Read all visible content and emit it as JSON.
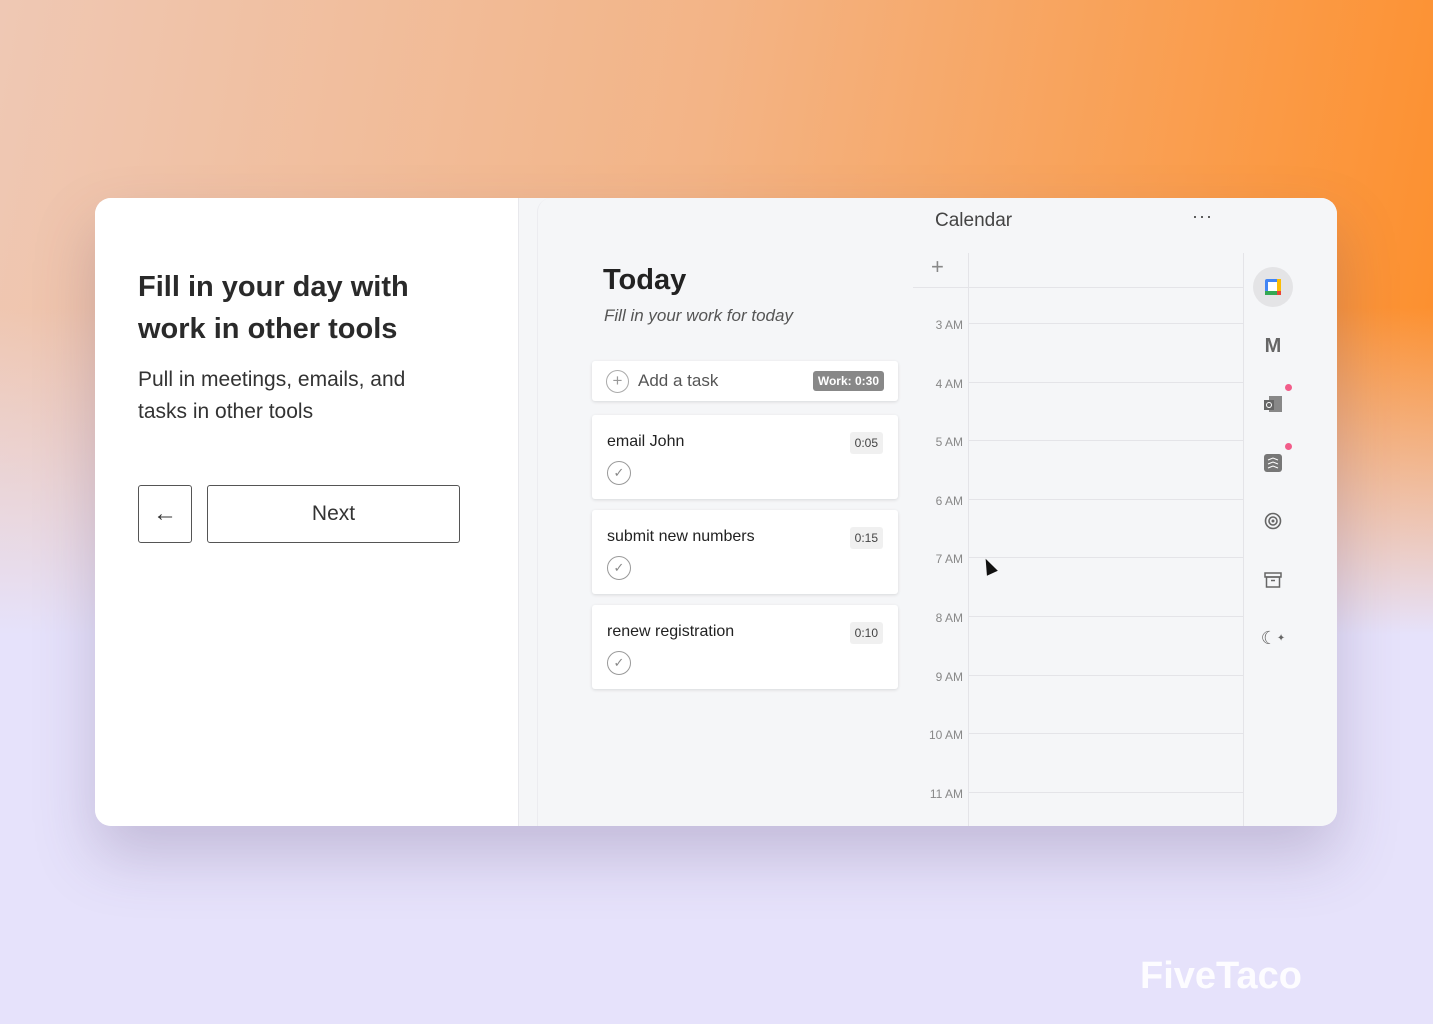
{
  "onboarding": {
    "title": "Fill in your day with work in other tools",
    "subtitle": "Pull in meetings, emails, and tasks in other tools",
    "back_icon": "arrow-left-icon",
    "next_label": "Next"
  },
  "calendar": {
    "title": "Calendar",
    "more_label": "···",
    "add_label": "+",
    "hours": [
      "3 AM",
      "4 AM",
      "5 AM",
      "6 AM",
      "7 AM",
      "8 AM",
      "9 AM",
      "10 AM",
      "11 AM"
    ]
  },
  "today": {
    "title": "Today",
    "subtitle": "Fill in your work for today",
    "add_task_placeholder": "Add a task",
    "work_total": "Work: 0:30",
    "tasks": [
      {
        "name": "email John",
        "duration": "0:05"
      },
      {
        "name": "submit new numbers",
        "duration": "0:15"
      },
      {
        "name": "renew registration",
        "duration": "0:10"
      }
    ]
  },
  "integrations": [
    {
      "icon": "google-calendar-icon",
      "active": true
    },
    {
      "icon": "gmail-icon"
    },
    {
      "icon": "outlook-icon",
      "notification": true
    },
    {
      "icon": "todoist-icon",
      "notification": true
    },
    {
      "icon": "target-icon"
    },
    {
      "icon": "archive-icon"
    },
    {
      "icon": "moon-stars-icon"
    }
  ],
  "brand": "FiveTaco",
  "colors": {
    "notification": "#f25d8a",
    "work_badge": "#888888"
  }
}
